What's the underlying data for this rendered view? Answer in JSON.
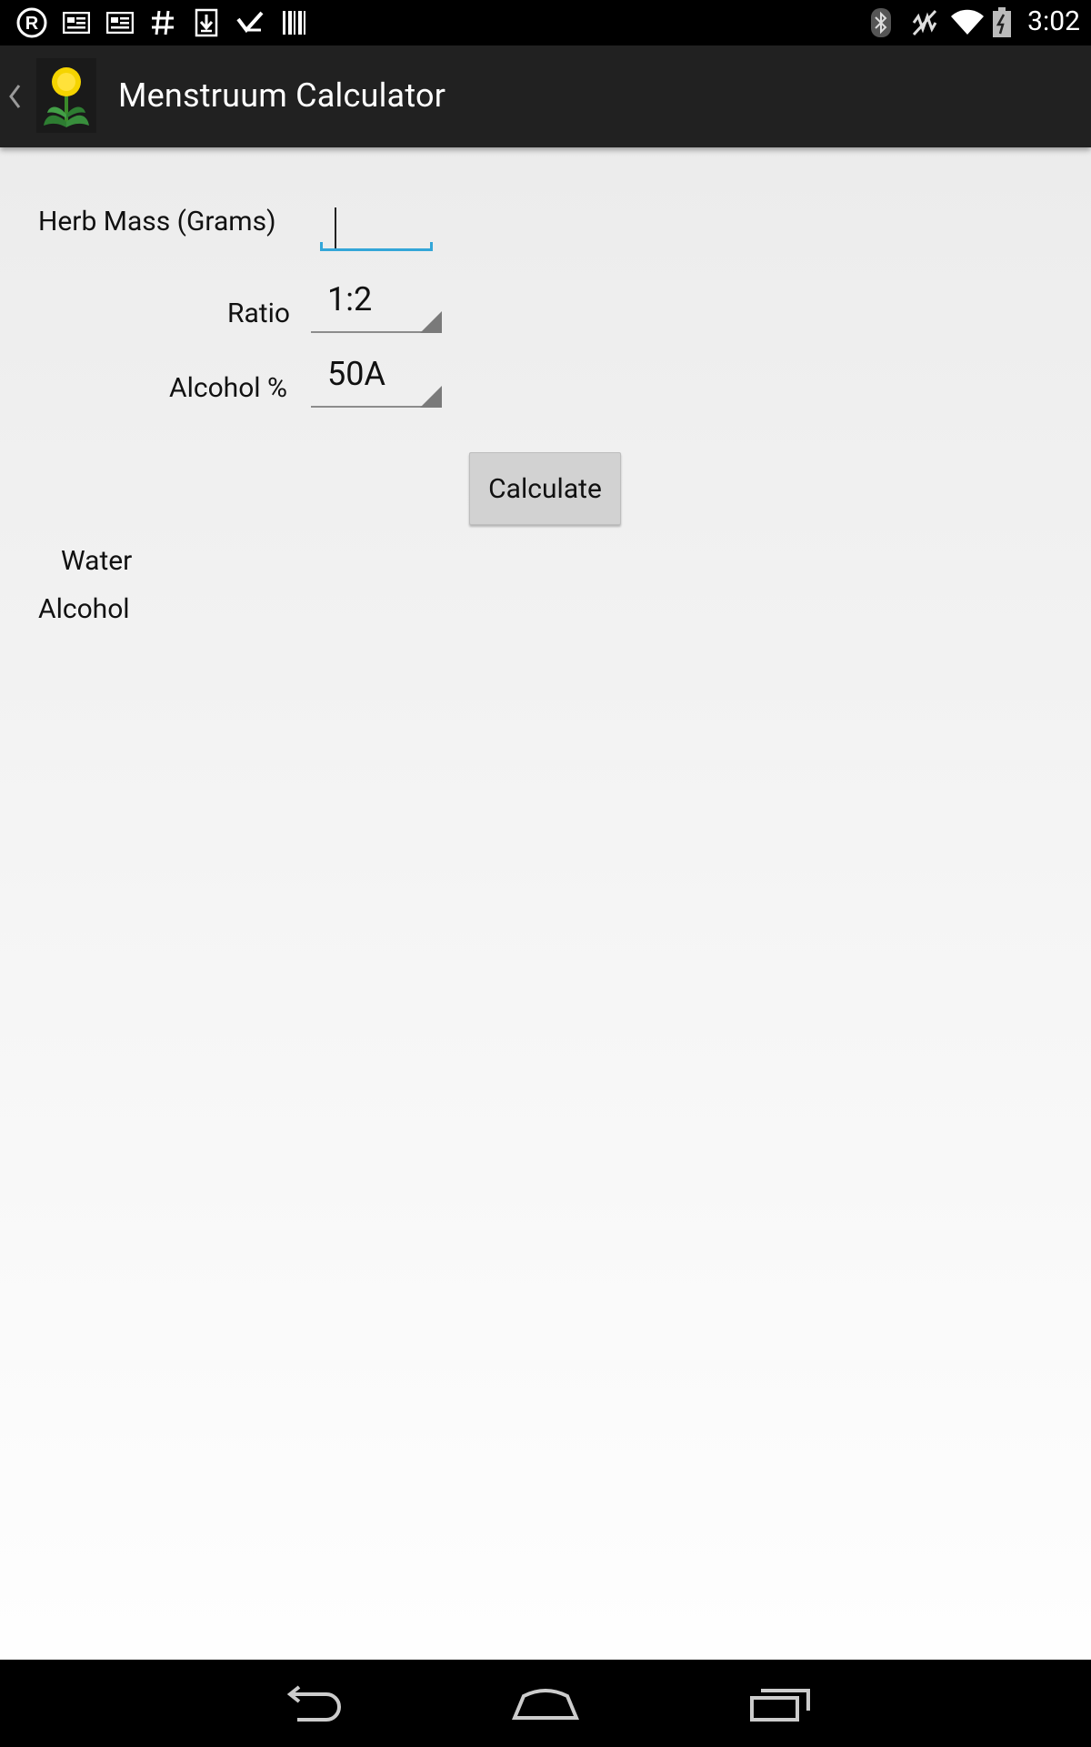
{
  "status_bar": {
    "time": "3:02",
    "left_icons": [
      "registered-icon",
      "news-icon",
      "news-icon",
      "hashtag-icon",
      "download-icon",
      "check-icon",
      "barcode-icon"
    ],
    "right_icons": [
      "bluetooth-icon",
      "vibrate-icon",
      "wifi-icon",
      "battery-icon"
    ]
  },
  "action_bar": {
    "title": "Menstruum Calculator",
    "up_icon": "chevron-left-icon",
    "app_icon": "dandelion-icon"
  },
  "form": {
    "herb_mass_label": "Herb Mass (Grams)",
    "herb_mass_value": "",
    "ratio_label": "Ratio",
    "ratio_value": "1:2",
    "alcohol_label": "Alcohol %",
    "alcohol_value": "50A",
    "calculate_label": "Calculate"
  },
  "results": {
    "water_label": "Water",
    "alcohol_label": "Alcohol"
  },
  "nav_bar": {
    "buttons": [
      "back-icon",
      "home-icon",
      "recents-icon"
    ]
  },
  "colors": {
    "accent": "#33a6d8",
    "action_bar": "#212121",
    "button": "#d2d2d2"
  }
}
